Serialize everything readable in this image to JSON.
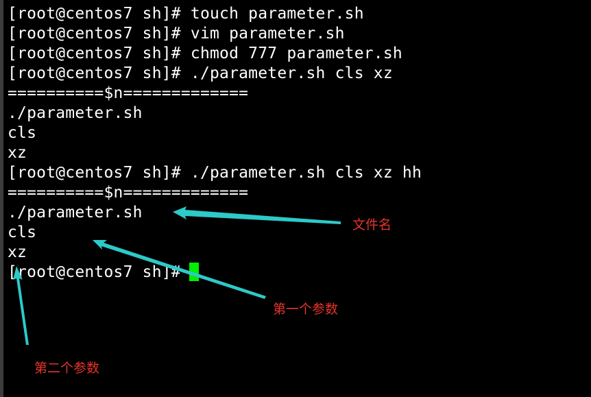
{
  "terminal": {
    "lines": [
      "[root@centos7 sh]# touch parameter.sh",
      "[root@centos7 sh]# vim parameter.sh",
      "[root@centos7 sh]# chmod 777 parameter.sh",
      "[root@centos7 sh]# ./parameter.sh cls xz",
      "==========$n=============",
      "./parameter.sh",
      "cls",
      "xz",
      "[root@centos7 sh]# ./parameter.sh cls xz hh",
      "==========$n=============",
      "./parameter.sh",
      "cls",
      "xz",
      "[root@centos7 sh]# "
    ],
    "cursor_color": "#00ee00",
    "background": "#000000",
    "foreground": "#ffffff"
  },
  "annotations": {
    "filename_label": "文件名",
    "first_param_label": "第一个参数",
    "second_param_label": "第二个参数",
    "label_color": "#e8342b",
    "arrow_color": "#2ec9c9"
  }
}
